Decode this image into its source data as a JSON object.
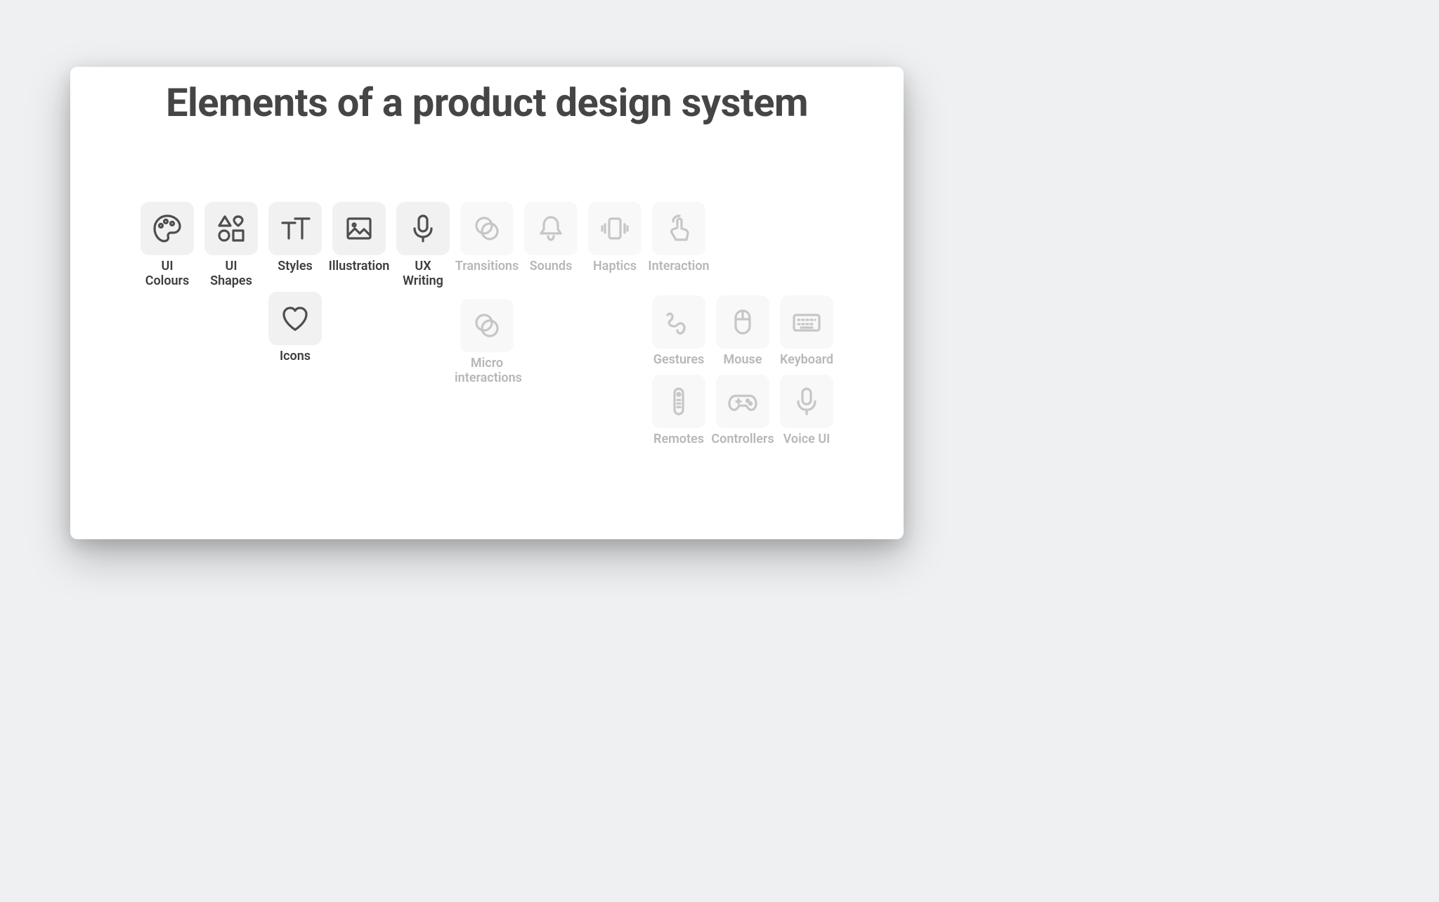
{
  "title": "Elements of a product design system",
  "row1": {
    "ui_colours": "UI\nColours",
    "ui_shapes": "UI\nShapes",
    "styles": "Styles",
    "illustration": "Illustration",
    "ux_writing": "UX\nWriting",
    "transitions": "Transitions",
    "sounds": "Sounds",
    "haptics": "Haptics",
    "interaction": "Interaction"
  },
  "row2": {
    "icons": "Icons",
    "micro_interactions": "Micro\ninteractions",
    "gestures": "Gestures",
    "mouse": "Mouse",
    "keyboard": "Keyboard"
  },
  "row3": {
    "remotes": "Remotes",
    "controllers": "Controllers",
    "voice_ui": "Voice UI"
  }
}
